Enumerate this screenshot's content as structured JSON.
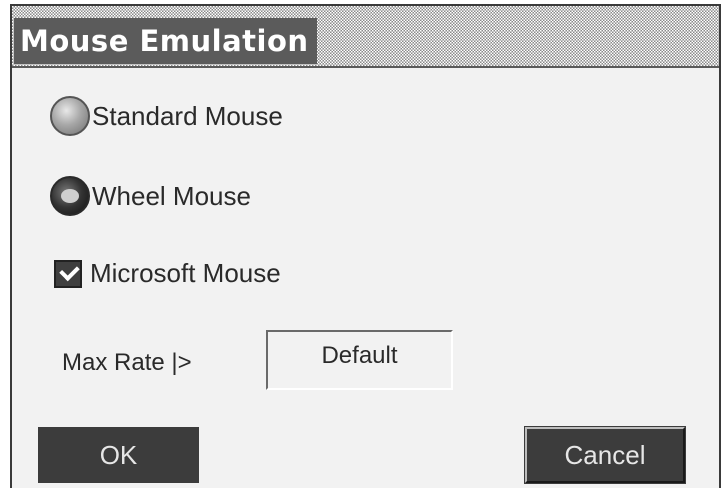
{
  "dialog": {
    "title": "Mouse Emulation",
    "options": {
      "standard_mouse": {
        "label": "Standard Mouse",
        "selected": false
      },
      "wheel_mouse": {
        "label": "Wheel Mouse",
        "selected": true
      },
      "microsoft_mouse": {
        "label": "Microsoft Mouse",
        "checked": true
      }
    },
    "max_rate": {
      "label": "Max Rate |>",
      "value": "Default"
    },
    "buttons": {
      "ok": "OK",
      "cancel": "Cancel"
    }
  }
}
